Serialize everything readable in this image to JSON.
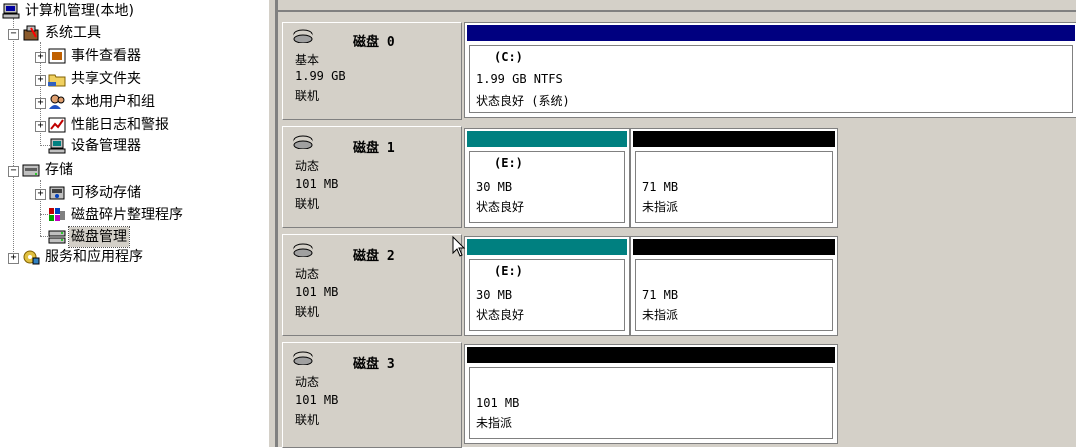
{
  "tree": {
    "root": "计算机管理(本地)",
    "system_tools": "系统工具",
    "event_viewer": "事件查看器",
    "shared_folders": "共享文件夹",
    "local_users": "本地用户和组",
    "perf_logs": "性能日志和警报",
    "device_manager": "设备管理器",
    "storage": "存储",
    "removable_storage": "可移动存储",
    "defrag": "磁盘碎片整理程序",
    "disk_mgmt": "磁盘管理",
    "services_apps": "服务和应用程序",
    "expander_plus": "+",
    "expander_minus": "−"
  },
  "disks": [
    {
      "title": "磁盘 0",
      "type": "基本",
      "size": "1.99 GB",
      "status": "联机",
      "volumes": [
        {
          "letter": "(C:)",
          "size": "1.99 GB NTFS",
          "status": "状态良好 (系统)",
          "bar_color": "#000080"
        }
      ]
    },
    {
      "title": "磁盘 1",
      "type": "动态",
      "size": "101 MB",
      "status": "联机",
      "volumes": [
        {
          "letter": "(E:)",
          "size": "30 MB",
          "status": "状态良好",
          "bar_color": "#008080"
        },
        {
          "letter": "",
          "size": "71 MB",
          "status": "未指派",
          "bar_color": "#000000"
        }
      ]
    },
    {
      "title": "磁盘 2",
      "type": "动态",
      "size": "101 MB",
      "status": "联机",
      "volumes": [
        {
          "letter": "(E:)",
          "size": "30 MB",
          "status": "状态良好",
          "bar_color": "#008080"
        },
        {
          "letter": "",
          "size": "71 MB",
          "status": "未指派",
          "bar_color": "#000000"
        }
      ]
    },
    {
      "title": "磁盘 3",
      "type": "动态",
      "size": "101 MB",
      "status": "联机",
      "volumes": [
        {
          "letter": "",
          "size": "101 MB",
          "status": "未指派",
          "bar_color": "#000000"
        }
      ]
    }
  ]
}
